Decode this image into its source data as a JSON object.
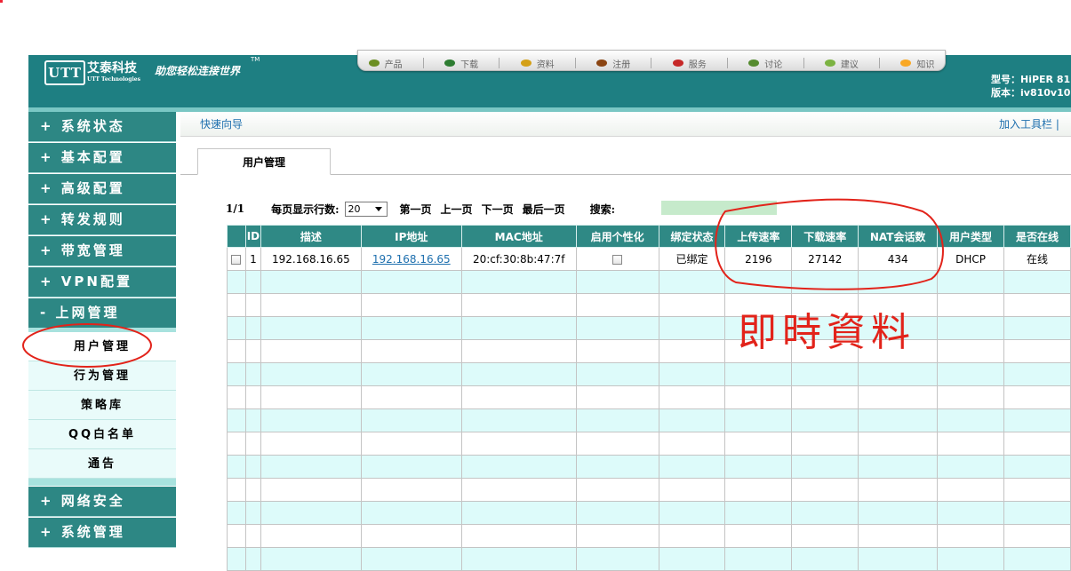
{
  "header": {
    "logo_text": "UTT",
    "brand_cn": "艾泰科技",
    "brand_en": "UTT Technologies",
    "slogan": "助您轻松连接世界",
    "trademark": "TM",
    "model_line": "型号：HiPER 81",
    "version_line": "版本：iv810v10",
    "nav": [
      {
        "label": "产品",
        "icon": "product-icon",
        "color": "#6b8e23"
      },
      {
        "label": "下载",
        "icon": "download-icon",
        "color": "#2e7d32"
      },
      {
        "label": "资料",
        "icon": "document-icon",
        "color": "#d4a017"
      },
      {
        "label": "注册",
        "icon": "register-icon",
        "color": "#8b4513"
      },
      {
        "label": "服务",
        "icon": "service-icon",
        "color": "#c62828"
      },
      {
        "label": "讨论",
        "icon": "discuss-icon",
        "color": "#558b2f"
      },
      {
        "label": "建议",
        "icon": "suggest-icon",
        "color": "#7cb342"
      },
      {
        "label": "知识",
        "icon": "knowledge-icon",
        "color": "#f9a825"
      }
    ]
  },
  "sidebar": {
    "items": [
      {
        "label": "+ 系统状态"
      },
      {
        "label": "+ 基本配置"
      },
      {
        "label": "+ 高级配置"
      },
      {
        "label": "+ 转发规则"
      },
      {
        "label": "+ 带宽管理"
      },
      {
        "label": "+ VPN配置"
      },
      {
        "label": "- 上网管理"
      }
    ],
    "subitems": [
      {
        "label": "用户管理",
        "active": true
      },
      {
        "label": "行为管理"
      },
      {
        "label": "策略库"
      },
      {
        "label": "QQ白名单"
      },
      {
        "label": "通告"
      }
    ],
    "bottom_items": [
      {
        "label": "+ 网络安全"
      },
      {
        "label": "+ 系统管理"
      }
    ]
  },
  "breadcrumb": "快速向导",
  "toolbar_link": "加入工具栏  |",
  "tab": "用户管理",
  "pager": {
    "page": "1/1",
    "rows_label": "每页显示行数:",
    "rows_value": "20",
    "first": "第一页",
    "prev": "上一页",
    "next": "下一页",
    "last": "最后一页",
    "search_label": "搜索:"
  },
  "table": {
    "columns": [
      "",
      "ID",
      "描述",
      "IP地址",
      "MAC地址",
      "启用个性化",
      "绑定状态",
      "上传速率",
      "下载速率",
      "NAT会话数",
      "用户类型",
      "是否在线"
    ],
    "rows": [
      {
        "id": "1",
        "desc": "192.168.16.65",
        "ip": "192.168.16.65",
        "mac": "20:cf:30:8b:47:7f",
        "bind": "已绑定",
        "up": "2196",
        "down": "27142",
        "nat": "434",
        "type": "DHCP",
        "online": "在线"
      }
    ],
    "empty_rows": 13
  },
  "annotation": {
    "text": "即時資料",
    "color": "#e2231a"
  }
}
